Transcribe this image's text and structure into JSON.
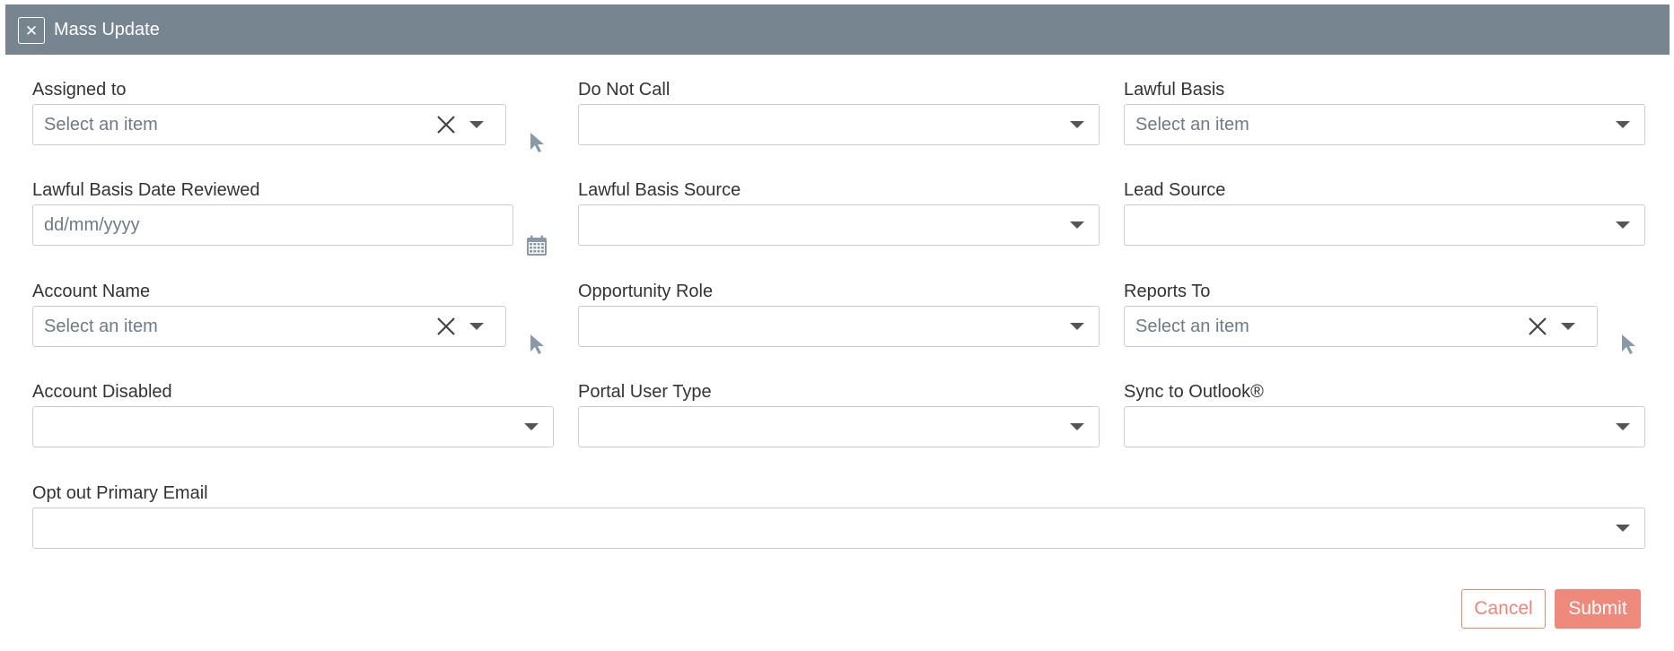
{
  "modal": {
    "title": "Mass Update",
    "close_icon": "close-icon"
  },
  "fields": {
    "assigned_to": {
      "label": "Assigned to",
      "placeholder": "Select an item"
    },
    "do_not_call": {
      "label": "Do Not Call",
      "value": ""
    },
    "lawful_basis": {
      "label": "Lawful Basis",
      "placeholder": "Select an item"
    },
    "lawful_basis_date": {
      "label": "Lawful Basis Date Reviewed",
      "placeholder": "dd/mm/yyyy"
    },
    "lawful_basis_source": {
      "label": "Lawful Basis Source",
      "value": ""
    },
    "lead_source": {
      "label": "Lead Source",
      "value": ""
    },
    "account_name": {
      "label": "Account Name",
      "placeholder": "Select an item"
    },
    "opportunity_role": {
      "label": "Opportunity Role",
      "value": ""
    },
    "reports_to": {
      "label": "Reports To",
      "placeholder": "Select an item"
    },
    "account_disabled": {
      "label": "Account Disabled",
      "value": ""
    },
    "portal_user_type": {
      "label": "Portal User Type",
      "value": ""
    },
    "sync_to_outlook": {
      "label": "Sync to Outlook®",
      "value": ""
    },
    "opt_out_primary_email": {
      "label": "Opt out Primary Email",
      "value": ""
    }
  },
  "actions": {
    "cancel_label": "Cancel",
    "submit_label": "Submit"
  },
  "colors": {
    "header_bg": "#778591",
    "accent": "#ed8a7c",
    "icon_muted": "#8a99a8"
  }
}
